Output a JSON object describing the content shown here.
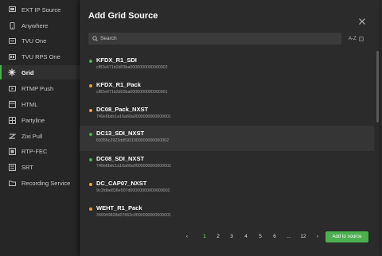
{
  "sidebar": {
    "items": [
      {
        "label": "EXT IP Source",
        "icon": "ip-source-icon",
        "active": false
      },
      {
        "label": "Anywhere",
        "icon": "anywhere-icon",
        "active": false
      },
      {
        "label": "TVU One",
        "icon": "tvu-one-icon",
        "active": false
      },
      {
        "label": "TVU RPS One",
        "icon": "tvu-rps-icon",
        "active": false
      },
      {
        "label": "Grid",
        "icon": "grid-icon",
        "active": true
      },
      {
        "label": "RTMP Push",
        "icon": "rtmp-icon",
        "active": false
      },
      {
        "label": "HTML",
        "icon": "html-icon",
        "active": false
      },
      {
        "label": "Partyline",
        "icon": "partyline-icon",
        "active": false
      },
      {
        "label": "Zixi Pull",
        "icon": "zixi-icon",
        "active": false
      },
      {
        "label": "RTP-FEC",
        "icon": "rtp-fec-icon",
        "active": false
      },
      {
        "label": "SRT",
        "icon": "srt-icon",
        "active": false
      },
      {
        "label": "Recording Service",
        "icon": "recording-icon",
        "active": false
      }
    ]
  },
  "modal": {
    "title": "Add Grid Source",
    "search_placeholder": "Search",
    "sort_label": "A-Z",
    "add_button": "Add to source"
  },
  "sources": [
    {
      "name": "KFDX_R1_SDI",
      "id": "cf82e671b2d03ba0000000000000002",
      "status": "online",
      "color": "#4caf50"
    },
    {
      "name": "KFDX_R1_Pack",
      "id": "cf82e671b2d03ba0000000000000001",
      "status": "busy",
      "color": "#e6a23c"
    },
    {
      "name": "DC08_Pack_NXST",
      "id": "749e6bdc1a16a60a0000000000000001",
      "status": "busy",
      "color": "#e6a23c"
    },
    {
      "name": "DC13_SDI_NXST",
      "id": "69356c2922dd5921000000000000002",
      "status": "online",
      "color": "#4caf50"
    },
    {
      "name": "DC08_SDI_NXST",
      "id": "749e6bdc1a16a60a0000000000000002",
      "status": "online",
      "color": "#4caf50"
    },
    {
      "name": "DC_CAP07_NXST",
      "id": "9c1fdbe836e507d00000000000000002",
      "status": "busy",
      "color": "#e6a23c"
    },
    {
      "name": "WEHT_R1_Pack",
      "id": "340949828d07663c0000000000000001",
      "status": "busy",
      "color": "#e6a23c"
    }
  ],
  "pagination": {
    "prev": "‹",
    "next": "›",
    "pages": [
      "1",
      "2",
      "3",
      "4",
      "5",
      "6",
      "...",
      "12"
    ],
    "current": "1"
  },
  "colors": {
    "accent": "#4caf50",
    "online": "#4caf50",
    "busy": "#e6a23c"
  }
}
